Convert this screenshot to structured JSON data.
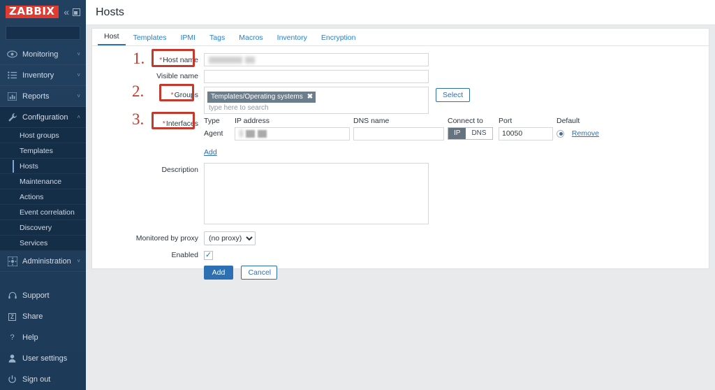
{
  "sidebar": {
    "logo": "ZABBIX",
    "collapse_icon": "chevron-double-left-icon",
    "kiosk_icon": "kiosk-mode-icon",
    "search_placeholder": "",
    "nav": [
      {
        "label": "Monitoring",
        "icon": "eye-icon",
        "chevron": "˅"
      },
      {
        "label": "Inventory",
        "icon": "list-icon",
        "chevron": "˅"
      },
      {
        "label": "Reports",
        "icon": "bar-chart-icon",
        "chevron": "˅"
      },
      {
        "label": "Configuration",
        "icon": "wrench-icon",
        "chevron": "˄"
      }
    ],
    "sub_items": [
      "Host groups",
      "Templates",
      "Hosts",
      "Maintenance",
      "Actions",
      "Event correlation",
      "Discovery",
      "Services"
    ],
    "active_sub": "Hosts",
    "admin": {
      "label": "Administration",
      "icon": "gear-icon",
      "chevron": "˅"
    },
    "bottom": [
      {
        "label": "Support",
        "icon": "headset-icon"
      },
      {
        "label": "Share",
        "icon": "share-z-icon"
      },
      {
        "label": "Help",
        "icon": "question-icon"
      },
      {
        "label": "User settings",
        "icon": "user-icon"
      },
      {
        "label": "Sign out",
        "icon": "power-icon"
      }
    ]
  },
  "header": {
    "title": "Hosts"
  },
  "tabs": [
    {
      "label": "Host",
      "active": true
    },
    {
      "label": "Templates",
      "active": false
    },
    {
      "label": "IPMI",
      "active": false
    },
    {
      "label": "Tags",
      "active": false
    },
    {
      "label": "Macros",
      "active": false
    },
    {
      "label": "Inventory",
      "active": false
    },
    {
      "label": "Encryption",
      "active": false
    }
  ],
  "form": {
    "host_name": {
      "label": "Host name",
      "required": true,
      "value": "",
      "redacted": true
    },
    "visible_name": {
      "label": "Visible name",
      "required": false,
      "value": ""
    },
    "groups": {
      "label": "Groups",
      "required": true,
      "chips": [
        "Templates/Operating systems"
      ],
      "chip_remove_icon": "✖",
      "placeholder": "type here to search",
      "select_button": "Select"
    },
    "interfaces": {
      "label": "Interfaces",
      "required": true,
      "columns": [
        "Type",
        "IP address",
        "DNS name",
        "Connect to",
        "Port",
        "Default"
      ],
      "rows": [
        {
          "type": "Agent",
          "ip": "",
          "ip_redacted": true,
          "dns": "",
          "connect_to": [
            "IP",
            "DNS"
          ],
          "connect_to_selected": "IP",
          "port": "10050",
          "default_checked": true,
          "remove_label": "Remove"
        }
      ],
      "add_label": "Add"
    },
    "description": {
      "label": "Description",
      "value": ""
    },
    "monitored_by_proxy": {
      "label": "Monitored by proxy",
      "value": "(no proxy)",
      "options": [
        "(no proxy)"
      ]
    },
    "enabled": {
      "label": "Enabled",
      "checked": true,
      "check_glyph": "✓"
    },
    "buttons": {
      "submit": "Add",
      "cancel": "Cancel"
    }
  },
  "annotations": {
    "color": "#c4392c",
    "items": [
      {
        "number": "1.",
        "target": "Host name"
      },
      {
        "number": "2.",
        "target": "Groups"
      },
      {
        "number": "3.",
        "target": "Interfaces"
      }
    ]
  }
}
